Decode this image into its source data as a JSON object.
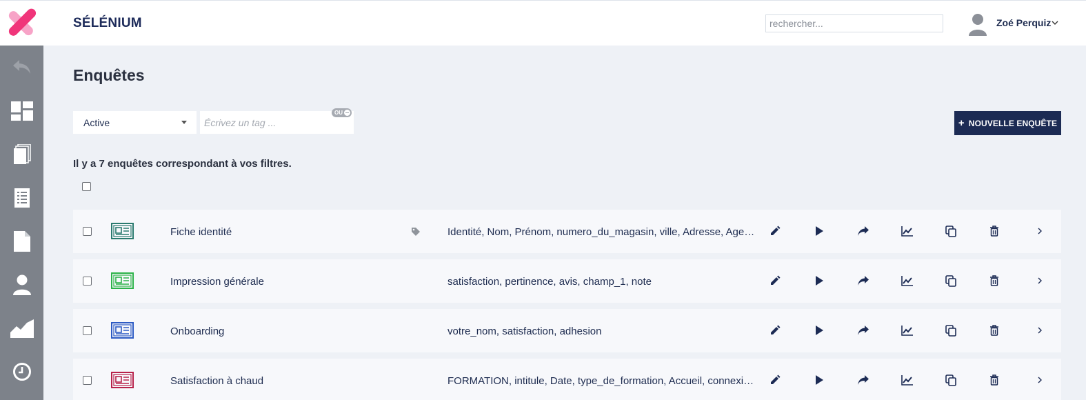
{
  "app": {
    "name": "SÉLÉNIUM"
  },
  "header": {
    "search_placeholder": "rechercher...",
    "user_name": "Zoé Perquiz"
  },
  "sidebar": {
    "items": [
      {
        "icon": "back-arrow-icon"
      },
      {
        "icon": "dashboard-icon"
      },
      {
        "icon": "pages-icon"
      },
      {
        "icon": "list-icon"
      },
      {
        "icon": "document-icon"
      },
      {
        "icon": "user-icon"
      },
      {
        "icon": "chart-area-icon"
      },
      {
        "icon": "clock-icon"
      }
    ]
  },
  "page": {
    "title": "Enquêtes",
    "status_filter": "Active",
    "tag_placeholder": "Écrivez un tag ...",
    "tag_mode": "OU",
    "new_button": "NOUVELLE ENQUÊTE",
    "result_text": "Il y a 7 enquêtes correspondant à vos filtres."
  },
  "surveys": [
    {
      "title": "Fiche identité",
      "color": "#2a7a6e",
      "has_tags": true,
      "fields": "Identité, Nom, Prénom, numero_du_magasin, ville, Adresse, Age, Date, type_de_formation, Accueil"
    },
    {
      "title": "Impression générale",
      "color": "#2db34a",
      "has_tags": false,
      "fields": "satisfaction, pertinence, avis, champ_1, note"
    },
    {
      "title": "Onboarding",
      "color": "#2d5bc4",
      "has_tags": false,
      "fields": "votre_nom, satisfaction, adhesion"
    },
    {
      "title": "Satisfaction à chaud",
      "color": "#b8224a",
      "has_tags": false,
      "fields": "FORMATION, intitule, Date, type_de_formation, Accueil, connexion, Disponibilite, duree"
    }
  ],
  "colors": {
    "primary": "#1c2b54",
    "sidebar": "#7d828a",
    "logo_pink": "#f0357a"
  }
}
